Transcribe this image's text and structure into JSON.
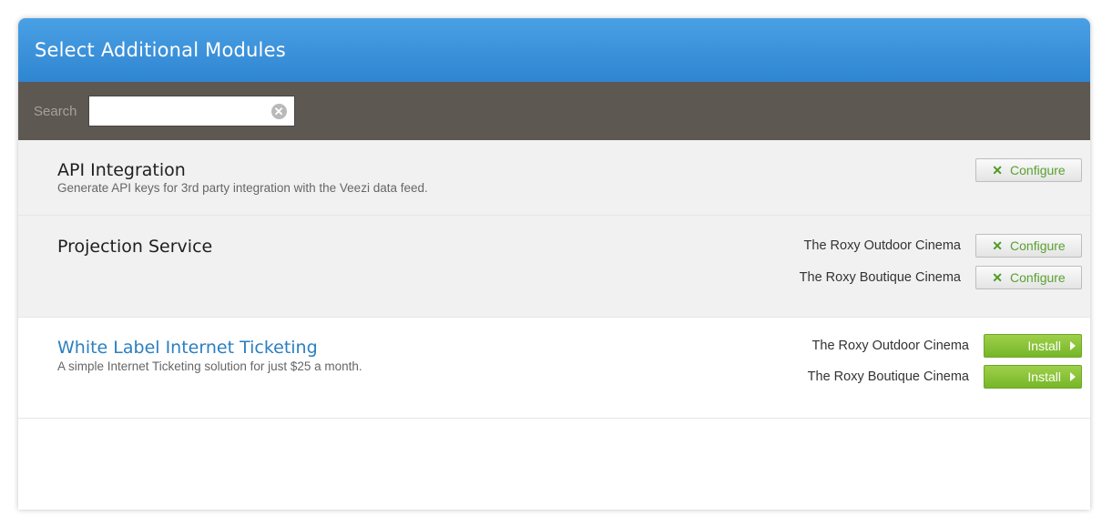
{
  "header": {
    "title": "Select Additional Modules"
  },
  "search": {
    "label": "Search",
    "value": "",
    "placeholder": ""
  },
  "modules": [
    {
      "name": "API Integration",
      "description": "Generate API keys for 3rd party integration with the Veezi data feed.",
      "actions": [
        {
          "venue": "",
          "button": "Configure"
        }
      ]
    },
    {
      "name": "Projection Service",
      "description": "",
      "actions": [
        {
          "venue": "The Roxy Outdoor Cinema",
          "button": "Configure"
        },
        {
          "venue": "The Roxy Boutique Cinema",
          "button": "Configure"
        }
      ]
    },
    {
      "name": "White Label Internet Ticketing",
      "description": "A simple Internet Ticketing solution for just $25 a month.",
      "actions": [
        {
          "venue": "The Roxy Outdoor Cinema",
          "button": "Install"
        },
        {
          "venue": "The Roxy Boutique Cinema",
          "button": "Install"
        }
      ]
    }
  ],
  "colors": {
    "header_blue": "#3a93dc",
    "search_bar": "#5e5853",
    "configure_green": "#5aa12f",
    "install_green": "#86c236",
    "link_blue": "#2b7fc0"
  },
  "icons": {
    "clear": "clear-search-icon",
    "configure": "x-icon",
    "install": "arrow-right-icon"
  }
}
